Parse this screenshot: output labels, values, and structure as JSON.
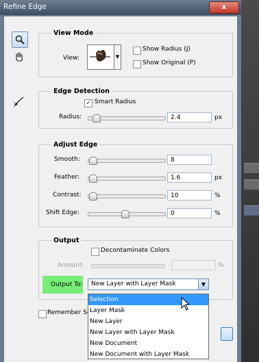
{
  "window": {
    "title": "Refine Edge",
    "close_label": "x"
  },
  "tools": {
    "zoom": "magnifier-icon",
    "hand": "hand-icon",
    "brush": "refine-brush-icon"
  },
  "view_mode": {
    "legend": "View Mode",
    "view_label": "View:",
    "show_radius": {
      "label": "Show Radius (J)",
      "checked": false
    },
    "show_original": {
      "label": "Show Original (P)",
      "checked": false
    }
  },
  "edge_detection": {
    "legend": "Edge Detection",
    "smart_radius": {
      "label": "Smart Radius",
      "checked": true
    },
    "radius": {
      "label": "Radius:",
      "value": "2.4",
      "unit": "px",
      "level": 0.05
    }
  },
  "adjust_edge": {
    "legend": "Adjust Edge",
    "smooth": {
      "label": "Smooth:",
      "value": "8",
      "unit": "",
      "level": 0.02
    },
    "feather": {
      "label": "Feather:",
      "value": "1.6",
      "unit": "px",
      "level": 0.02
    },
    "contrast": {
      "label": "Contrast:",
      "value": "10",
      "unit": "%",
      "level": 0.02
    },
    "shift_edge": {
      "label": "Shift Edge:",
      "value": "0",
      "unit": "%",
      "level": 0.5
    }
  },
  "output": {
    "legend": "Output",
    "decontaminate": {
      "label": "Decontaminate Colors",
      "checked": false
    },
    "amount": {
      "label": "Amount:",
      "value": "",
      "unit": "%"
    },
    "output_to_label": "Output To:",
    "output_to_value": "New Layer with Layer Mask",
    "options": [
      "Selection",
      "Layer Mask",
      "New Layer",
      "New Layer with Layer Mask",
      "New Document",
      "New Document with Layer Mask"
    ],
    "highlighted_option": "Selection"
  },
  "remember": {
    "label": "Remember Se"
  }
}
